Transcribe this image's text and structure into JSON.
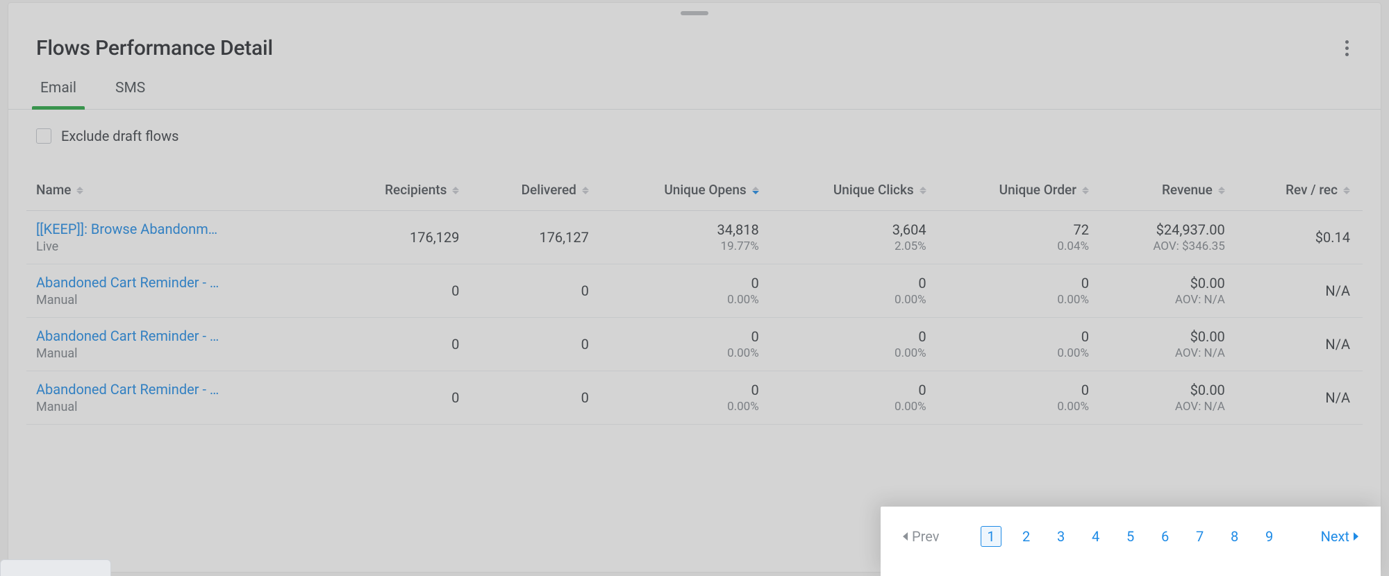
{
  "title": "Flows Performance Detail",
  "tabs": {
    "email": "Email",
    "sms": "SMS"
  },
  "filter": {
    "exclude_draft_label": "Exclude draft flows"
  },
  "columns": {
    "name": "Name",
    "recipients": "Recipients",
    "delivered": "Delivered",
    "unique_opens": "Unique Opens",
    "unique_clicks": "Unique Clicks",
    "unique_order": "Unique Order",
    "revenue": "Revenue",
    "rev_per_rec": "Rev / rec"
  },
  "rows": [
    {
      "name": "[[KEEP]]: Browse Abandonm…",
      "status": "Live",
      "recipients": "176,129",
      "delivered": "176,127",
      "opens": "34,818",
      "opens_pct": "19.77%",
      "clicks": "3,604",
      "clicks_pct": "2.05%",
      "orders": "72",
      "orders_pct": "0.04%",
      "revenue": "$24,937.00",
      "aov": "AOV: $346.35",
      "rev_per_rec": "$0.14"
    },
    {
      "name": "Abandoned Cart Reminder - …",
      "status": "Manual",
      "recipients": "0",
      "delivered": "0",
      "opens": "0",
      "opens_pct": "0.00%",
      "clicks": "0",
      "clicks_pct": "0.00%",
      "orders": "0",
      "orders_pct": "0.00%",
      "revenue": "$0.00",
      "aov": "AOV: N/A",
      "rev_per_rec": "N/A"
    },
    {
      "name": "Abandoned Cart Reminder - …",
      "status": "Manual",
      "recipients": "0",
      "delivered": "0",
      "opens": "0",
      "opens_pct": "0.00%",
      "clicks": "0",
      "clicks_pct": "0.00%",
      "orders": "0",
      "orders_pct": "0.00%",
      "revenue": "$0.00",
      "aov": "AOV: N/A",
      "rev_per_rec": "N/A"
    },
    {
      "name": "Abandoned Cart Reminder - …",
      "status": "Manual",
      "recipients": "0",
      "delivered": "0",
      "opens": "0",
      "opens_pct": "0.00%",
      "clicks": "0",
      "clicks_pct": "0.00%",
      "orders": "0",
      "orders_pct": "0.00%",
      "revenue": "$0.00",
      "aov": "AOV: N/A",
      "rev_per_rec": "N/A"
    }
  ],
  "pagination": {
    "prev": "Prev",
    "next": "Next",
    "pages": [
      "1",
      "2",
      "3",
      "4",
      "5",
      "6",
      "7",
      "8",
      "9"
    ],
    "current": "1"
  }
}
